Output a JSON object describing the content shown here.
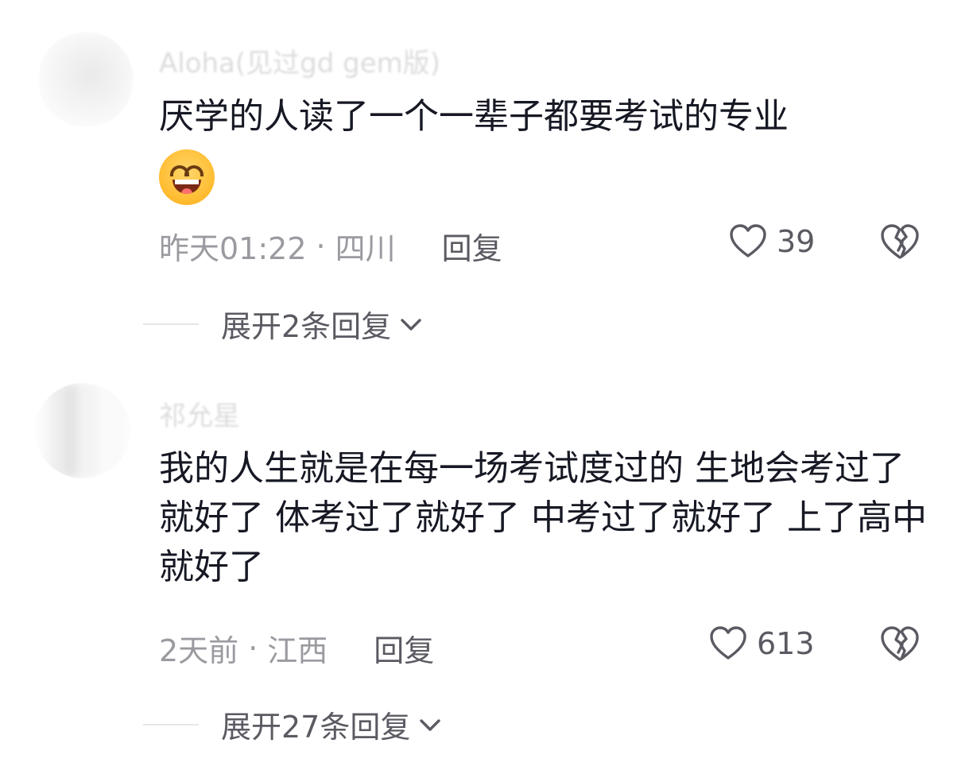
{
  "comments": [
    {
      "username": "Aloha(见过gd gem版)",
      "text": "厌学的人读了一个一辈子都要考试的专业",
      "emoji": "grinning-face-emoji",
      "time": "昨天01:22",
      "separator": "·",
      "location": "四川",
      "reply_label": "回复",
      "likes": "39",
      "expand_label": "展开2条回复"
    },
    {
      "username": "祁允星",
      "text": "我的人生就是在每一场考试度过的 生地会考过了就好了 体考过了就好了 中考过了就好了 上了高中就好了",
      "time": "2天前",
      "separator": "·",
      "location": "江西",
      "reply_label": "回复",
      "likes": "613",
      "expand_label": "展开27条回复"
    }
  ],
  "icons": {
    "like": "heart-outline-icon",
    "dislike": "broken-heart-icon",
    "expand": "chevron-down-icon"
  },
  "colors": {
    "text": "#161823",
    "meta": "#9a9aa0",
    "action": "#5a5a62"
  }
}
